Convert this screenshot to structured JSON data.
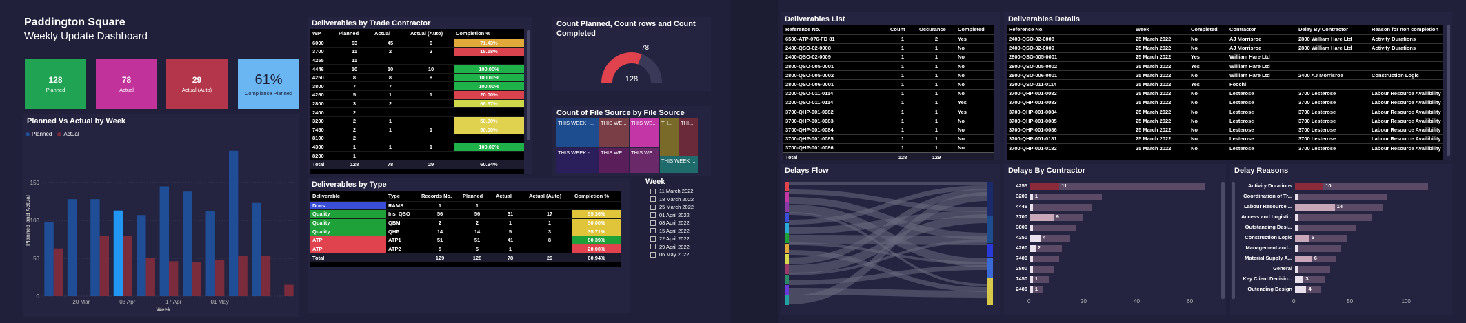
{
  "header": {
    "title": "Paddington Square",
    "subtitle": "Weekly Update Dashboard"
  },
  "kpis": [
    {
      "value": "128",
      "label": "Planned",
      "color": "#20a353"
    },
    {
      "value": "78",
      "label": "Actual",
      "color": "#c2329b"
    },
    {
      "value": "29",
      "label": "Actual (Auto)",
      "color": "#b3364a"
    },
    {
      "value": "61%",
      "label": "Compliance Planned",
      "color": "#6ab6f2"
    }
  ],
  "trade": {
    "title": "Deliverables by Trade Contractor",
    "columns": [
      "WP",
      "Planned",
      "Actual",
      "Actual (Auto)",
      "Completion %"
    ],
    "rows": [
      [
        "6000",
        "63",
        "45",
        "6",
        "71.43%"
      ],
      [
        "3700",
        "11",
        "2",
        "2",
        "18.18%"
      ],
      [
        "4255",
        "11",
        "",
        "",
        ""
      ],
      [
        "4446",
        "10",
        "10",
        "10",
        "100.00%"
      ],
      [
        "4250",
        "8",
        "8",
        "8",
        "100.00%"
      ],
      [
        "3800",
        "7",
        "7",
        "",
        "100.00%"
      ],
      [
        "4260",
        "5",
        "1",
        "1",
        "20.00%"
      ],
      [
        "2800",
        "3",
        "2",
        "",
        "66.67%"
      ],
      [
        "2400",
        "2",
        "",
        "",
        ""
      ],
      [
        "3200",
        "2",
        "1",
        "",
        "50.00%"
      ],
      [
        "7450",
        "2",
        "1",
        "1",
        "50.00%"
      ],
      [
        "8100",
        "2",
        "",
        "",
        ""
      ],
      [
        "4300",
        "1",
        "1",
        "1",
        "100.00%"
      ],
      [
        "8200",
        "1",
        "",
        "",
        ""
      ]
    ],
    "cell_colors": [
      "#e0a93a",
      "#d9434e",
      "",
      "#1fb14a",
      "#1fb14a",
      "#1fb14a",
      "#d9434e",
      "#cfd84a",
      "",
      "#e0d24e",
      "#e0d24e",
      "",
      "#1fb14a",
      ""
    ],
    "total": [
      "Total",
      "128",
      "78",
      "29",
      "60.94%"
    ]
  },
  "gauge": {
    "title": "Count Planned, Count rows and Count Completed",
    "min": 0,
    "max": 128,
    "value": 78,
    "label_value": "78",
    "label_max": "128",
    "color": "#e0434e"
  },
  "treemap": {
    "title": "Count of File Source by File Source",
    "tiles": [
      {
        "label": "THIS WEEK -...",
        "color": "#1e4d8f"
      },
      {
        "label": "THIS WE...",
        "color": "#7a3f46"
      },
      {
        "label": "THIS WE...",
        "color": "#c236a6"
      },
      {
        "label": "TH...",
        "color": "#7a6a2a"
      },
      {
        "label": "THI...",
        "color": "#6a2a3a"
      },
      {
        "label": "THIS WEEK -...",
        "color": "#2a1f5a"
      },
      {
        "label": "THIS WE...",
        "color": "#5a1f5a"
      },
      {
        "label": "THIS WE...",
        "color": "#6a2a6a"
      },
      {
        "label": "THIS WEEK ...",
        "color": "#1f6a6a"
      }
    ]
  },
  "barchart": {
    "title": "Planned Vs Actual by Week",
    "xlabel": "Week",
    "ylabel": "Planned and Actual",
    "legend": [
      "Planned",
      "Actual"
    ]
  },
  "chart_data": {
    "type": "bar",
    "title": "Planned Vs Actual by Week",
    "xlabel": "Week",
    "ylabel": "Planned and Actual",
    "ylim": [
      0,
      200
    ],
    "yticks": [
      0,
      50,
      100,
      150
    ],
    "x_tick_labels": [
      "20 Mar",
      "03 Apr",
      "17 Apr",
      "01 May"
    ],
    "x_tick_positions": [
      2,
      4,
      6,
      8
    ],
    "categories": [
      "w1",
      "w2",
      "w3",
      "w4",
      "w5",
      "w6",
      "w7",
      "w8",
      "w9",
      "w10",
      "w11"
    ],
    "highlight_index": 3,
    "series": [
      {
        "name": "Planned",
        "color": "#1f4e96",
        "values": [
          98,
          128,
          128,
          113,
          107,
          145,
          138,
          112,
          192,
          123,
          0
        ]
      },
      {
        "name": "Actual",
        "color": "#7a2b3c",
        "values": [
          63,
          0,
          80,
          80,
          50,
          46,
          45,
          48,
          53,
          53,
          15
        ]
      }
    ]
  },
  "types": {
    "title": "Deliverables by Type",
    "columns": [
      "Deliverable",
      "Type",
      "Records No.",
      "Planned",
      "Actual",
      "Actual (Auto)",
      "Completion %"
    ],
    "rows": [
      [
        "Docs",
        "RAMS",
        "1",
        "1",
        "",
        "",
        ""
      ],
      [
        "Quality",
        "Ins_QSO",
        "56",
        "56",
        "31",
        "17",
        "55.36%"
      ],
      [
        "Quality",
        "QBM",
        "2",
        "2",
        "1",
        "1",
        "50.00%"
      ],
      [
        "Quality",
        "QHP",
        "14",
        "14",
        "5",
        "3",
        "35.71%"
      ],
      [
        "ATP",
        "ATP1",
        "51",
        "51",
        "41",
        "8",
        "80.39%"
      ],
      [
        "ATP",
        "ATP2",
        "5",
        "5",
        "1",
        "",
        "20.00%"
      ]
    ],
    "row_colors": [
      "#3a4ed8",
      "#1fa13a",
      "#1fa13a",
      "#1fa13a",
      "#e0434e",
      "#e0434e"
    ],
    "cell_colors": [
      "",
      "#e0c43a",
      "#e0c43a",
      "#e0c43a",
      "#1fa13a",
      "#e0434e"
    ],
    "total": [
      "Total",
      "",
      "129",
      "128",
      "78",
      "29",
      "60.94%"
    ]
  },
  "week_filter": {
    "title": "Week",
    "items": [
      "11 March 2022",
      "18 March 2022",
      "25 March 2022",
      "01 April 2022",
      "08 April 2022",
      "15 April 2022",
      "22 April 2022",
      "29 April 2022",
      "06 May 2022"
    ]
  },
  "deliv_list": {
    "title": "Deliverables List",
    "columns": [
      "Reference No.",
      "Count",
      "Occurance",
      "Completed"
    ],
    "rows": [
      [
        "6500-ATP-076-FD 81",
        "1",
        "2",
        "Yes"
      ],
      [
        "2400-QSO-02-0008",
        "1",
        "1",
        "No"
      ],
      [
        "2400-QSO-02-0009",
        "1",
        "1",
        "No"
      ],
      [
        "2800-QSO-005-0001",
        "1",
        "1",
        "No"
      ],
      [
        "2800-QSO-005-0002",
        "1",
        "1",
        "No"
      ],
      [
        "2800-QSO-006-0001",
        "1",
        "1",
        "No"
      ],
      [
        "3200-QSO-011-0114",
        "1",
        "1",
        "No"
      ],
      [
        "3200-QSO-011-0114",
        "1",
        "1",
        "Yes"
      ],
      [
        "3700-QHP-001-0082",
        "1",
        "1",
        "Yes"
      ],
      [
        "3700-QHP-001-0083",
        "1",
        "1",
        "No"
      ],
      [
        "3700-QHP-001-0084",
        "1",
        "1",
        "No"
      ],
      [
        "3700-QHP-001-0085",
        "1",
        "1",
        "No"
      ],
      [
        "3700-QHP-001-0086",
        "1",
        "1",
        "No"
      ]
    ],
    "partial_row": [
      "3700-QHP-001-0181",
      "1",
      "1",
      "No"
    ],
    "total": [
      "Total",
      "128",
      "129",
      ""
    ]
  },
  "deliv_details": {
    "title": "Deliverables Details",
    "columns": [
      "Reference No.",
      "Week",
      "Completed",
      "Contractor",
      "Delay By Contractor",
      "Reason for non completion"
    ],
    "rows": [
      [
        "2400-QSO-02-0008",
        "25 March 2022",
        "No",
        "AJ Morrisroe",
        "2800 William Hare Ltd",
        "Activity Durations"
      ],
      [
        "2400-QSO-02-0009",
        "25 March 2022",
        "No",
        "AJ Morrisroe",
        "2800 William Hare Ltd",
        "Activity Durations"
      ],
      [
        "2800-QSO-005-0001",
        "25 March 2022",
        "Yes",
        "William Hare Ltd",
        "",
        ""
      ],
      [
        "2800-QSO-005-0002",
        "25 March 2022",
        "Yes",
        "William Hare Ltd",
        "",
        ""
      ],
      [
        "2800-QSO-006-0001",
        "25 March 2022",
        "No",
        "William Hare Ltd",
        "2400 AJ Morrisroe",
        "Construction Logic"
      ],
      [
        "3200-QSO-011-0114",
        "25 March 2022",
        "Yes",
        "Focchi",
        "",
        ""
      ],
      [
        "3700-QHP-001-0082",
        "25 March 2022",
        "No",
        "Lesterose",
        "3700 Lesterose",
        "Labour Resource Availibility"
      ],
      [
        "3700-QHP-001-0083",
        "25 March 2022",
        "No",
        "Lesterose",
        "3700 Lesterose",
        "Labour Resource Availibility"
      ],
      [
        "3700-QHP-001-0084",
        "25 March 2022",
        "No",
        "Lesterose",
        "3700 Lesterose",
        "Labour Resource Availibility"
      ],
      [
        "3700-QHP-001-0085",
        "25 March 2022",
        "No",
        "Lesterose",
        "3700 Lesterose",
        "Labour Resource Availibility"
      ],
      [
        "3700-QHP-001-0086",
        "25 March 2022",
        "No",
        "Lesterose",
        "3700 Lesterose",
        "Labour Resource Availibility"
      ],
      [
        "3700-QHP-001-0181",
        "25 March 2022",
        "No",
        "Lesterose",
        "3700 Lesterose",
        "Labour Resource Availibility"
      ],
      [
        "3700-QHP-001-0182",
        "25 March 2022",
        "No",
        "Lesterose",
        "3700 Lesterose",
        "Labour Resource Availibility"
      ]
    ]
  },
  "delays_flow": {
    "title": "Delays Flow",
    "left_colors": [
      "#e0434e",
      "#c236a6",
      "#8a3aa6",
      "#3a4ed8",
      "#2aa8d8",
      "#1fa13a",
      "#e0a93a",
      "#d8d84a",
      "#9a3a6a",
      "#2a8a6a",
      "#6a3ad8",
      "#1fa1a1"
    ],
    "right_colors": [
      "#1a2a6a",
      "#1a2a6a",
      "#1e4d8f",
      "#2a3ad8",
      "#3a6ad8",
      "#d8c84a"
    ]
  },
  "delays_contractor": {
    "title": "Delays By Contractor",
    "categories": [
      "4255",
      "3200",
      "4446",
      "3700",
      "3800",
      "4250",
      "4260",
      "7400",
      "2800",
      "7450",
      "2400"
    ],
    "values": [
      11,
      1,
      1,
      9,
      1,
      4,
      2,
      1,
      1,
      1,
      1
    ],
    "ghost_values": [
      66,
      27,
      23,
      20,
      17,
      15,
      12,
      11,
      9,
      7,
      5
    ],
    "value_labels": [
      "11",
      "1",
      "",
      "9",
      "",
      "4",
      "2",
      "",
      "",
      "1",
      "1"
    ],
    "xticks": [
      "0",
      "20",
      "40",
      "60"
    ],
    "xmax": 68
  },
  "delay_reasons": {
    "title": "Delay Reasons",
    "categories": [
      "Activity Durations",
      "Coordination of Tr...",
      "Labour Resource ...",
      "Access and Logisti...",
      "Outstanding Desi...",
      "Construction Logic",
      "Management and...",
      "Material Supply A...",
      "General",
      "Key Client Decisio...",
      "Outending Design"
    ],
    "values": [
      10,
      1,
      14,
      1,
      1,
      5,
      1,
      6,
      1,
      3,
      4
    ],
    "ghost_values": [
      122,
      84,
      80,
      70,
      56,
      48,
      42,
      38,
      32,
      28,
      24
    ],
    "value_labels": [
      "10",
      "",
      "14",
      "",
      "",
      "5",
      "",
      "6",
      "",
      "3",
      "4"
    ],
    "xticks": [
      "0",
      "50",
      "100"
    ],
    "xmax": 130
  }
}
